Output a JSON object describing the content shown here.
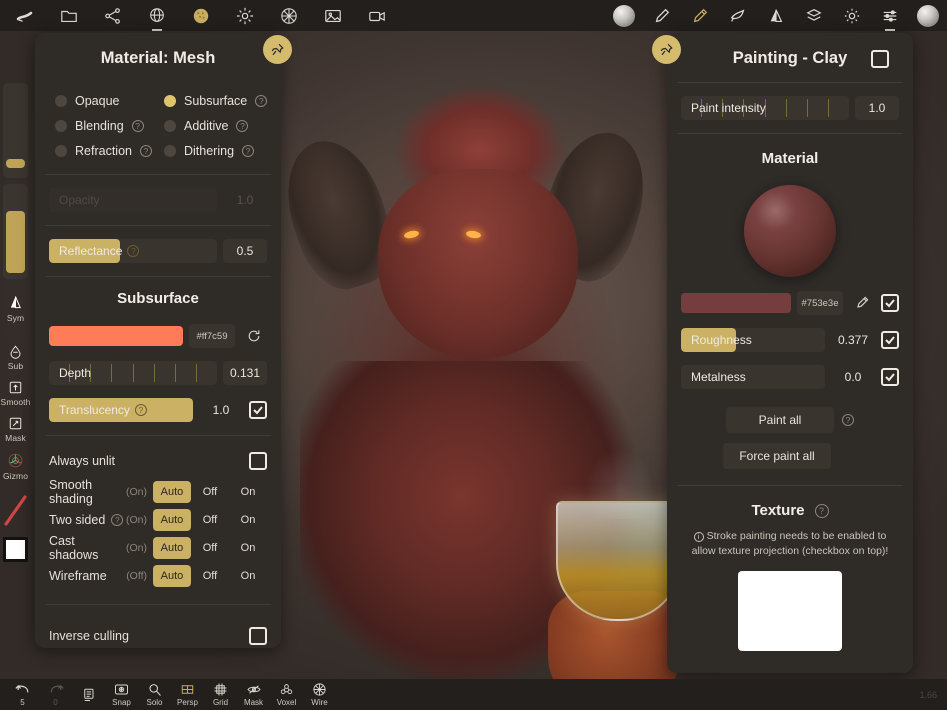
{
  "app": {
    "viewport_label": "3d-sculpting-viewport"
  },
  "topbar": {
    "left_icons": [
      {
        "name": "sculpt-icon",
        "glyph": "sculpt"
      },
      {
        "name": "folder-icon",
        "glyph": "folder"
      },
      {
        "name": "share-icon",
        "glyph": "share"
      },
      {
        "name": "scene-icon",
        "glyph": "scene"
      },
      {
        "name": "matcap-icon",
        "glyph": "matcap"
      },
      {
        "name": "light-icon",
        "glyph": "light"
      },
      {
        "name": "environment-icon",
        "glyph": "environment"
      },
      {
        "name": "image-icon",
        "glyph": "image"
      },
      {
        "name": "camera-icon",
        "glyph": "camera"
      }
    ],
    "right_icons": [
      {
        "name": "material-sphere-icon",
        "glyph": "sphere"
      },
      {
        "name": "brush-icon",
        "glyph": "brush"
      },
      {
        "name": "paint-icon",
        "glyph": "paint"
      },
      {
        "name": "eraser-icon",
        "glyph": "eraser"
      },
      {
        "name": "symmetry-icon",
        "glyph": "symmetry"
      },
      {
        "name": "layers-icon",
        "glyph": "layers"
      },
      {
        "name": "settings-icon",
        "glyph": "gear"
      },
      {
        "name": "sliders-icon",
        "glyph": "sliders"
      },
      {
        "name": "material-preview-icon",
        "glyph": "sphere"
      }
    ]
  },
  "leftrail": {
    "sliders": [
      {
        "name": "brush-size-slider",
        "value_pct": 10
      },
      {
        "name": "brush-intensity-slider",
        "value_pct": 65
      }
    ],
    "items": [
      {
        "name": "sym",
        "label": "Sym",
        "icon": "symmetry-icon"
      },
      {
        "name": "sub",
        "label": "Sub",
        "icon": "subdivide-icon"
      },
      {
        "name": "smooth",
        "label": "Smooth",
        "icon": "smooth-icon"
      },
      {
        "name": "mask",
        "label": "Mask",
        "icon": "mask-icon"
      },
      {
        "name": "gizmo",
        "label": "Gizmo",
        "icon": "gizmo-icon"
      }
    ],
    "stroke_preview_name": "stroke-preview",
    "color_swatch": "#ffffff"
  },
  "left_panel": {
    "title": "Material: Mesh",
    "pin_icon": "pin-icon",
    "blend_modes": [
      {
        "label": "Opaque",
        "selected": false,
        "help": false
      },
      {
        "label": "Subsurface",
        "selected": true,
        "help": true
      },
      {
        "label": "Blending",
        "selected": false,
        "help": true
      },
      {
        "label": "Additive",
        "selected": false,
        "help": true
      },
      {
        "label": "Refraction",
        "selected": false,
        "help": true
      },
      {
        "label": "Dithering",
        "selected": false,
        "help": true
      }
    ],
    "opacity": {
      "label": "Opacity",
      "value": "1.0",
      "disabled": true,
      "fill_pct": 0
    },
    "reflectance": {
      "label": "Reflectance",
      "value": "0.5",
      "fill_pct": 42,
      "help": true
    },
    "subsurface": {
      "title": "Subsurface",
      "color_hex": "#ff7c59",
      "color_label": "#ff7c59",
      "reset_icon": "reset-icon",
      "depth": {
        "label": "Depth",
        "value": "0.131",
        "ticks": 8
      },
      "translucency": {
        "label": "Translucency",
        "value": "1.0",
        "fill_pct": 100,
        "checked": true,
        "help": true
      }
    },
    "always_unlit": {
      "label": "Always unlit",
      "checked": false
    },
    "toggles": [
      {
        "label": "Smooth shading",
        "state": "(On)",
        "options": [
          "Auto",
          "Off",
          "On"
        ],
        "active": "Auto",
        "help": false
      },
      {
        "label": "Two sided",
        "state": "(On)",
        "options": [
          "Auto",
          "Off",
          "On"
        ],
        "active": "Auto",
        "help": true
      },
      {
        "label": "Cast shadows",
        "state": "(On)",
        "options": [
          "Auto",
          "Off",
          "On"
        ],
        "active": "Auto",
        "help": false
      },
      {
        "label": "Wireframe",
        "state": "(Off)",
        "options": [
          "Auto",
          "Off",
          "On"
        ],
        "active": "Auto",
        "help": false
      }
    ],
    "inverse_culling": {
      "label": "Inverse culling",
      "checked": false
    }
  },
  "right_panel": {
    "title": "Painting - Clay",
    "title_checkbox_checked": false,
    "pin_icon": "pin-icon",
    "paint_intensity": {
      "label": "Paint intensity",
      "value": "1.0",
      "ticks": 8
    },
    "material": {
      "title": "Material",
      "preview_name": "material-sphere-preview",
      "color_hex": "#753e3e",
      "color_label": "#753e3e",
      "eyedropper_icon": "eyedropper-icon",
      "color_checked": true,
      "roughness": {
        "label": "Roughness",
        "value": "0.377",
        "fill_pct": 38,
        "checked": true
      },
      "metalness": {
        "label": "Metalness",
        "value": "0.0",
        "fill_pct": 0,
        "checked": true
      }
    },
    "paint_all_button": "Paint all",
    "paint_all_help": true,
    "force_paint_all_button": "Force paint all",
    "texture": {
      "title": "Texture",
      "help": true,
      "warning": "Stroke painting needs to be enabled to allow texture projection (checkbox on top)!",
      "preview_name": "texture-preview"
    }
  },
  "bottombar": {
    "items": [
      {
        "name": "undo-button",
        "label": "5",
        "icon": "undo-icon",
        "gold": false,
        "dim": false
      },
      {
        "name": "redo-button",
        "label": "0",
        "icon": "redo-icon",
        "gold": false,
        "dim": true
      },
      {
        "name": "list-button",
        "label": "",
        "icon": "list-icon",
        "gold": false,
        "dim": false
      },
      {
        "name": "snap-button",
        "label": "Snap",
        "icon": "snap-icon",
        "gold": false,
        "dim": false
      },
      {
        "name": "solo-button",
        "label": "Solo",
        "icon": "solo-icon",
        "gold": false,
        "dim": false
      },
      {
        "name": "persp-button",
        "label": "Persp",
        "icon": "persp-icon",
        "gold": true,
        "dim": false
      },
      {
        "name": "grid-button",
        "label": "Grid",
        "icon": "grid-icon",
        "gold": false,
        "dim": false
      },
      {
        "name": "mask-button",
        "label": "Mask",
        "icon": "mask-hidden-icon",
        "gold": false,
        "dim": false
      },
      {
        "name": "voxel-button",
        "label": "Voxel",
        "icon": "voxel-icon",
        "gold": false,
        "dim": false
      },
      {
        "name": "wire-button",
        "label": "Wire",
        "icon": "wire-icon",
        "gold": false,
        "dim": false
      }
    ],
    "status": "1.66"
  }
}
